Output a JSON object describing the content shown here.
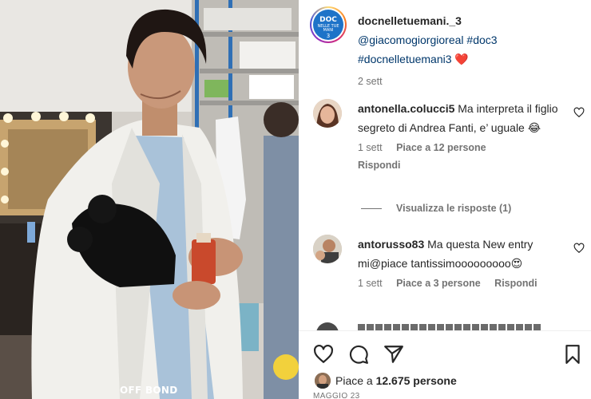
{
  "media": {
    "watermark": "OFF BOND"
  },
  "post": {
    "username": "docnelletuemani._3",
    "mention": "@giacomogiorgioreal",
    "hashtag_1": "#doc3",
    "hashtag_2": "#docnelletuemani3",
    "emoji": "❤️",
    "time": "2 sett",
    "avatar_logo": {
      "line1": "DOC",
      "line2": "NELLE TUE MANI",
      "line3": "3"
    }
  },
  "comments": [
    {
      "username": "antonella.colucci5",
      "text": "Ma interpreta il figlio segreto di Andrea Fanti, e’ uguale 😂",
      "time": "1 sett",
      "likes": "Piace a 12 persone",
      "reply": "Rispondi",
      "view_replies": "Visualizza le risposte (1)"
    },
    {
      "username": "antorusso83",
      "text": "Ma questa New entry mi@piace tantissimooooooooo😍",
      "time": "1 sett",
      "likes": "Piace a 3 persone",
      "reply": "Rispondi"
    }
  ],
  "footer": {
    "likes_prefix": "Piace a ",
    "likes_count": "12.675 persone",
    "date": "MAGGIO 23"
  },
  "colors": {
    "text": "#262626",
    "secondary": "#737373",
    "link": "#00376b",
    "heart": "#ed4956",
    "logo_blue": "#1e73c8"
  },
  "icons": [
    "heart-icon",
    "comment-icon",
    "share-icon",
    "bookmark-icon",
    "like-comment-icon"
  ]
}
